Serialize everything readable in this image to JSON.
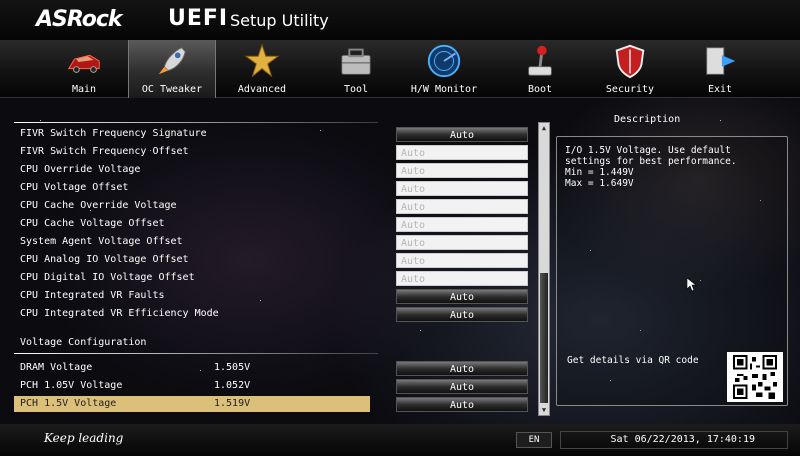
{
  "brand": {
    "logo": "ASRock",
    "uefi": "UEFI",
    "utility": "Setup Utility"
  },
  "tabs": [
    {
      "label": "Main",
      "icon": "sports-car-icon"
    },
    {
      "label": "OC Tweaker",
      "icon": "rocket-icon"
    },
    {
      "label": "Advanced",
      "icon": "star-icon"
    },
    {
      "label": "Tool",
      "icon": "toolbox-icon"
    },
    {
      "label": "H/W Monitor",
      "icon": "radar-icon"
    },
    {
      "label": "Boot",
      "icon": "joystick-icon"
    },
    {
      "label": "Security",
      "icon": "shield-icon"
    },
    {
      "label": "Exit",
      "icon": "exit-door-icon"
    }
  ],
  "active_tab": "OC Tweaker",
  "settings": [
    {
      "label": "FIVR Switch Frequency Signature",
      "value": "Auto",
      "style": "dark"
    },
    {
      "label": "FIVR Switch Frequency Offset",
      "value": "Auto",
      "style": "light"
    },
    {
      "label": "CPU Override Voltage",
      "value": "Auto",
      "style": "light"
    },
    {
      "label": "CPU Voltage Offset",
      "value": "Auto",
      "style": "light"
    },
    {
      "label": "CPU Cache Override Voltage",
      "value": "Auto",
      "style": "light"
    },
    {
      "label": "CPU Cache Voltage Offset",
      "value": "Auto",
      "style": "light"
    },
    {
      "label": "System Agent Voltage Offset",
      "value": "Auto",
      "style": "light"
    },
    {
      "label": "CPU Analog IO Voltage Offset",
      "value": "Auto",
      "style": "light"
    },
    {
      "label": "CPU Digital IO Voltage Offset",
      "value": "Auto",
      "style": "light"
    },
    {
      "label": "CPU Integrated VR Faults",
      "value": "Auto",
      "style": "dark"
    },
    {
      "label": "CPU Integrated VR Efficiency Mode",
      "value": "Auto",
      "style": "dark"
    }
  ],
  "voltage_section": {
    "header": "Voltage Configuration",
    "items": [
      {
        "label": "DRAM Voltage",
        "current": "1.505V",
        "value": "Auto"
      },
      {
        "label": "PCH 1.05V Voltage",
        "current": "1.052V",
        "value": "Auto"
      },
      {
        "label": "PCH 1.5V Voltage",
        "current": "1.519V",
        "value": "Auto"
      }
    ]
  },
  "description": {
    "title": "Description",
    "lines": [
      "I/O 1.5V Voltage. Use default",
      "settings for best performance.",
      "Min = 1.449V",
      "Max = 1.649V"
    ],
    "qr_label": "Get details via QR code"
  },
  "footer": {
    "signature": "Keep leading",
    "language": "EN",
    "datetime": "Sat 06/22/2013, 17:40:19"
  },
  "colors": {
    "highlight": "#dcbf78",
    "panel_background": "#0b0b10"
  }
}
